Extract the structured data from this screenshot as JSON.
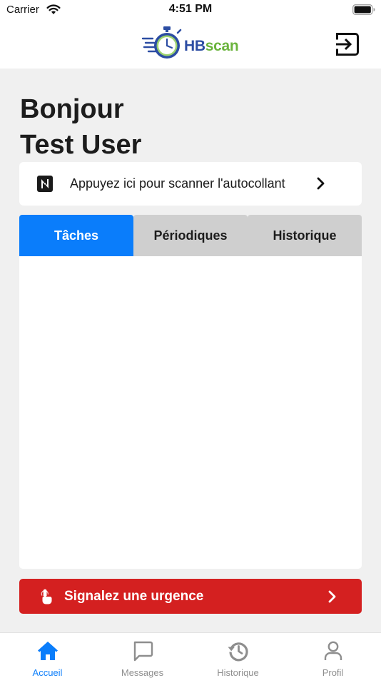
{
  "status_bar": {
    "carrier": "Carrier",
    "time": "4:51 PM"
  },
  "header": {
    "logo": {
      "part1": "HB",
      "part2": "scan"
    },
    "logout_icon": "logout-icon"
  },
  "greeting": {
    "line1": "Bonjour",
    "line2": "Test User"
  },
  "scan": {
    "label": "Appuyez ici pour scanner l'autocollant",
    "icon": "nfc-icon"
  },
  "tabs": [
    {
      "label": "Tâches",
      "active": true
    },
    {
      "label": "Périodiques",
      "active": false
    },
    {
      "label": "Historique",
      "active": false
    }
  ],
  "urgence": {
    "label": "Signalez une urgence",
    "icon": "touch-icon"
  },
  "tabbar": {
    "items": [
      {
        "label": "Accueil",
        "icon": "home-icon",
        "active": true
      },
      {
        "label": "Messages",
        "icon": "message-icon",
        "active": false
      },
      {
        "label": "Historique",
        "icon": "history-icon",
        "active": false
      },
      {
        "label": "Profil",
        "icon": "user-icon",
        "active": false
      }
    ]
  },
  "colors": {
    "accent": "#0a7dfb",
    "danger": "#d42020",
    "tab_inactive": "#cfcfcf",
    "background": "#f0f0f0",
    "logo_blue": "#2c4da3",
    "logo_green": "#6bb43d"
  }
}
